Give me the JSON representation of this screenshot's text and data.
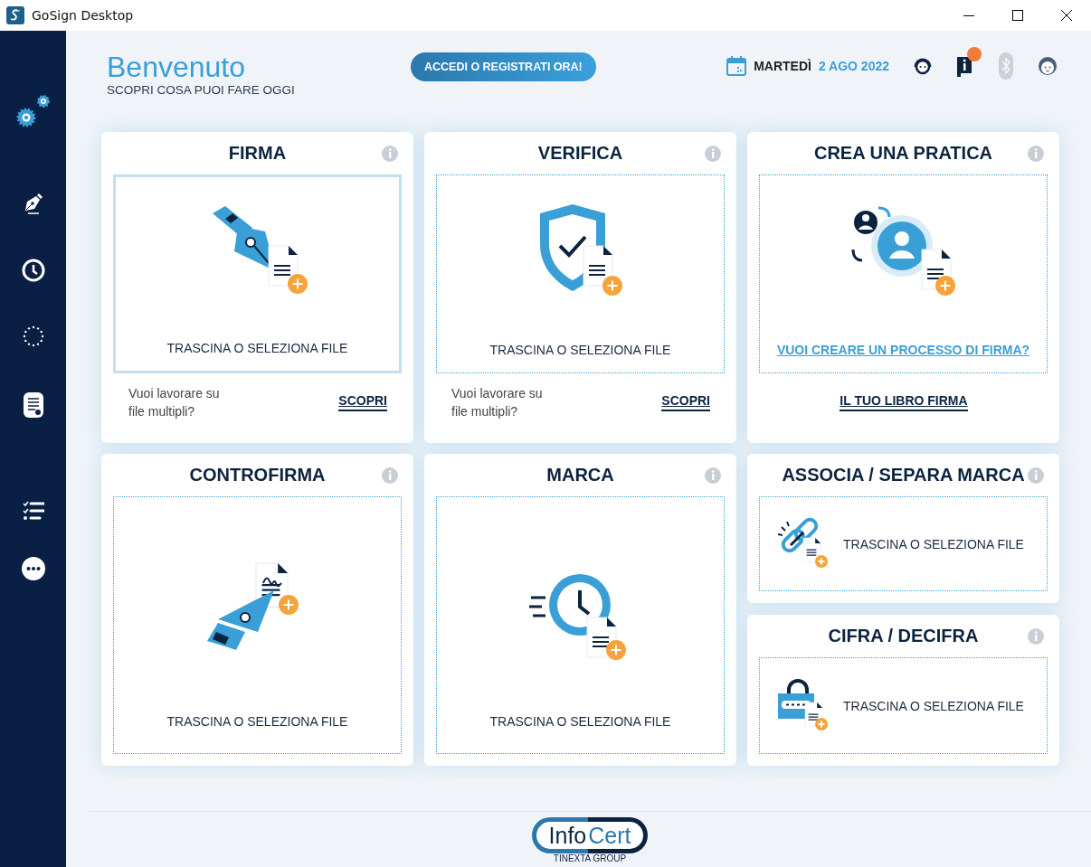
{
  "window": {
    "title": "GoSign Desktop"
  },
  "header": {
    "title": "Benvenuto",
    "subtitle": "SCOPRI COSA PUOI FARE OGGI",
    "login_button": "ACCEDI O REGISTRATI ORA!",
    "weekday": "MARTEDÌ",
    "date": "2 AGO 2022",
    "icons": [
      {
        "disabled": false,
        "notification": false
      },
      {
        "disabled": false,
        "notification": true
      },
      {
        "disabled": true,
        "notification": false
      },
      {
        "disabled": false,
        "notification": false
      }
    ]
  },
  "cards": [
    {
      "kind": "big",
      "title": "FIRMA",
      "selected": true,
      "drop_text": "TRASCINA O SELEZIONA FILE",
      "footer": {
        "kind": "multi",
        "text": "Vuoi lavorare su file multipli?",
        "link": "SCOPRI"
      }
    },
    {
      "kind": "big",
      "title": "VERIFICA",
      "selected": false,
      "drop_text": "TRASCINA O SELEZIONA FILE",
      "footer": {
        "kind": "multi",
        "text": "Vuoi lavorare su file multipli?",
        "link": "SCOPRI"
      }
    },
    {
      "kind": "big",
      "title": "CREA UNA PRATICA",
      "selected": false,
      "drop_link": "VUOI CREARE UN PROCESSO DI FIRMA?",
      "footer": {
        "kind": "link",
        "link": "IL TUO LIBRO FIRMA"
      }
    },
    {
      "kind": "tall",
      "title": "CONTROFIRMA",
      "selected": false,
      "drop_text": "TRASCINA O SELEZIONA FILE"
    },
    {
      "kind": "tall",
      "title": "MARCA",
      "selected": false,
      "drop_text": "TRASCINA O SELEZIONA FILE"
    },
    {
      "kind": "small",
      "title": "ASSOCIA / SEPARA MARCA",
      "selected": false,
      "drop_text": "TRASCINA O SELEZIONA FILE"
    },
    {
      "kind": "small",
      "title": "CIFRA / DECIFRA",
      "selected": false,
      "drop_text": "TRASCINA O SELEZIONA FILE"
    }
  ],
  "footer": {
    "logo_left": "Info",
    "logo_right": "Cert",
    "group": "TINEXTA GROUP"
  }
}
